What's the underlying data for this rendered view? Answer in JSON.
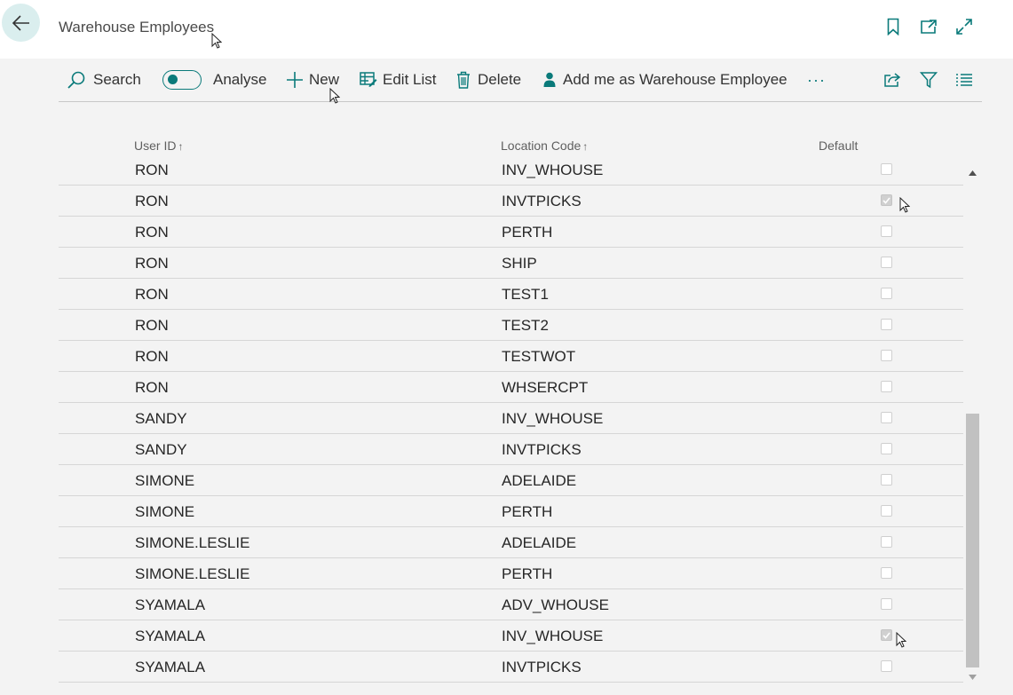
{
  "header": {
    "title": "Warehouse Employees",
    "back_icon": "arrow-left-icon",
    "right_icons": [
      "bookmark-icon",
      "open-new-window-icon",
      "expand-icon"
    ]
  },
  "actions": {
    "search": "Search",
    "analyse": "Analyse",
    "analyse_on": false,
    "new": "New",
    "edit_list": "Edit List",
    "delete": "Delete",
    "add_me": "Add me as Warehouse Employee",
    "more": "···",
    "right_icons": [
      "share-icon",
      "filter-icon",
      "list-icon"
    ]
  },
  "columns": {
    "user_id": "User ID",
    "location_code": "Location Code",
    "default": "Default",
    "sort_arrow": "↑"
  },
  "rows": [
    {
      "user_id": "RON",
      "location_code": "INV_WHOUSE",
      "default": false
    },
    {
      "user_id": "RON",
      "location_code": "INVTPICKS",
      "default": true
    },
    {
      "user_id": "RON",
      "location_code": "PERTH",
      "default": false
    },
    {
      "user_id": "RON",
      "location_code": "SHIP",
      "default": false
    },
    {
      "user_id": "RON",
      "location_code": "TEST1",
      "default": false
    },
    {
      "user_id": "RON",
      "location_code": "TEST2",
      "default": false
    },
    {
      "user_id": "RON",
      "location_code": "TESTWOT",
      "default": false
    },
    {
      "user_id": "RON",
      "location_code": "WHSERCPT",
      "default": false
    },
    {
      "user_id": "SANDY",
      "location_code": "INV_WHOUSE",
      "default": false
    },
    {
      "user_id": "SANDY",
      "location_code": "INVTPICKS",
      "default": false
    },
    {
      "user_id": "SIMONE",
      "location_code": "ADELAIDE",
      "default": false
    },
    {
      "user_id": "SIMONE",
      "location_code": "PERTH",
      "default": false
    },
    {
      "user_id": "SIMONE.LESLIE",
      "location_code": "ADELAIDE",
      "default": false
    },
    {
      "user_id": "SIMONE.LESLIE",
      "location_code": "PERTH",
      "default": false
    },
    {
      "user_id": "SYAMALA",
      "location_code": "ADV_WHOUSE",
      "default": false
    },
    {
      "user_id": "SYAMALA",
      "location_code": "INV_WHOUSE",
      "default": true
    },
    {
      "user_id": "SYAMALA",
      "location_code": "INVTPICKS",
      "default": false
    }
  ],
  "colors": {
    "accent": "#0a7a7a",
    "back_button_bg": "#daeeee",
    "page_bg": "#f3f3f3"
  }
}
